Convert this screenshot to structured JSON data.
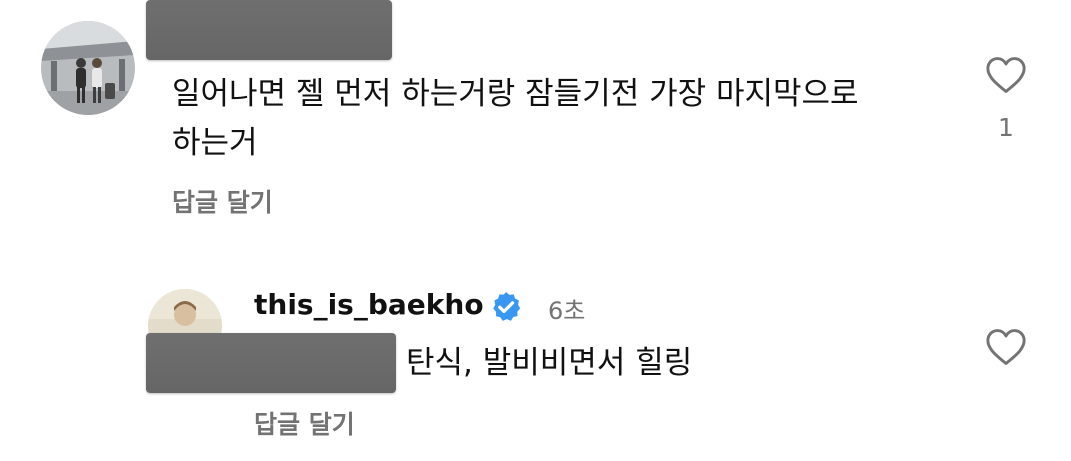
{
  "comments": [
    {
      "text_line1": "일어나면 젤 먼저 하는거랑 잠들기전 가장 마지막으로",
      "text_line2": "하는거",
      "reply_label": "답글 달기",
      "like_count": "1",
      "avatar_icon": "user-photo-avatar"
    },
    {
      "username": "this_is_baekho",
      "verified_icon": "verified-badge-icon",
      "timestamp": "6초",
      "text": "탄식, 발비비면서 힐링",
      "reply_label": "답글 달기",
      "avatar_icon": "user-photo-avatar"
    }
  ],
  "icons": {
    "like": "heart-outline-icon"
  },
  "colors": {
    "text": "#111111",
    "secondary": "#737373",
    "verified": "#3897f0",
    "redaction": "#6b6b6b"
  }
}
